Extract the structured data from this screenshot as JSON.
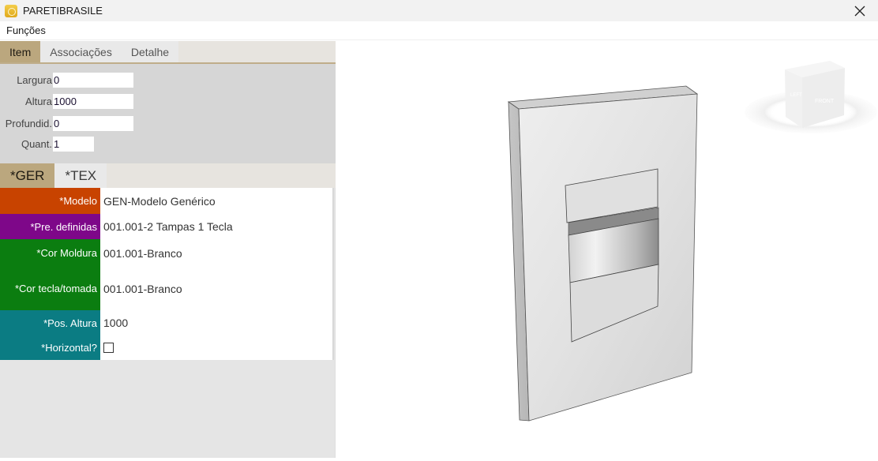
{
  "window": {
    "title": "PARETIBRASILE",
    "close_icon": "close-x-icon",
    "app_icon": "app-logo-icon"
  },
  "menu": {
    "items": [
      {
        "label": "Funções"
      }
    ]
  },
  "top_tabs": [
    {
      "label": "Item",
      "active": true
    },
    {
      "label": "Associações",
      "active": false
    },
    {
      "label": "Detalhe",
      "active": false
    }
  ],
  "item_form": {
    "fields": [
      {
        "label": "Largura",
        "value": "0"
      },
      {
        "label": "Altura",
        "value": "1000"
      },
      {
        "label": "Profundid.",
        "value": "0"
      },
      {
        "label": "Quant.",
        "value": "1"
      }
    ]
  },
  "sub_tabs": [
    {
      "label": "*GER",
      "active": true
    },
    {
      "label": "*TEX",
      "active": false
    }
  ],
  "properties": [
    {
      "label": "*Modelo",
      "value": "GEN-Modelo Genérico",
      "color": "#c84300"
    },
    {
      "label": "*Pre. definidas",
      "value": "001.001-2 Tampas 1 Tecla",
      "color": "#7e0789"
    },
    {
      "label": "*Cor Moldura",
      "value": "001.001-Branco",
      "color": "#0b7d10"
    },
    {
      "label": "*Cor tecla/tomada",
      "value": "001.001-Branco",
      "color": "#0b7d10"
    },
    {
      "label": "*Pos. Altura",
      "value": "1000",
      "color": "#0b7c83"
    },
    {
      "label": "*Horizontal?",
      "value": "",
      "checked": false,
      "color": "#0b7c83"
    }
  ],
  "viewcube": {
    "faces": [
      "FRONT",
      "LEFT"
    ]
  }
}
